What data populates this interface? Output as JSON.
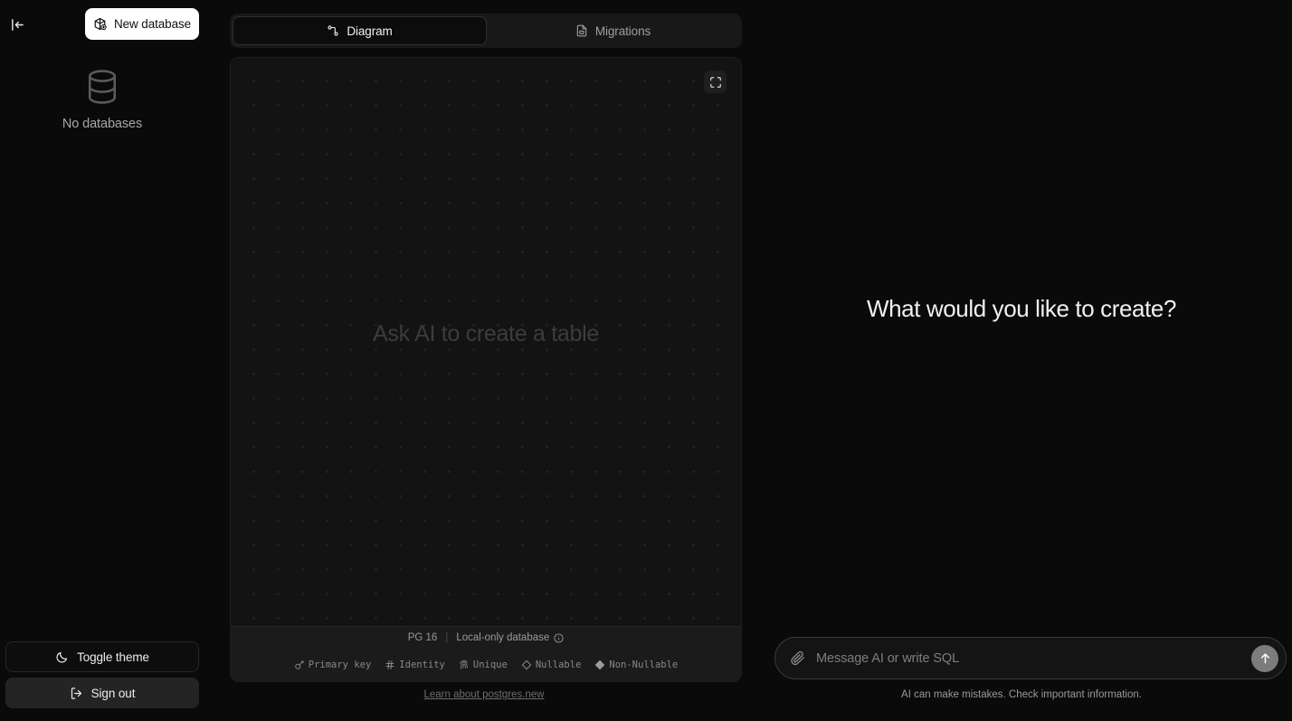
{
  "sidebar": {
    "collapse_icon": "panel-collapse-left-icon",
    "new_database": {
      "label": "New database",
      "icon": "database-plus-icon"
    },
    "empty_state": {
      "icon": "database-cylinder-icon",
      "label": "No databases"
    },
    "footer_buttons": [
      {
        "label": "Toggle theme",
        "icon": "moon-icon"
      },
      {
        "label": "Sign out",
        "icon": "sign-out-icon"
      }
    ]
  },
  "tabs": [
    {
      "label": "Diagram",
      "icon": "workflow-nodes-icon",
      "active": true
    },
    {
      "label": "Migrations",
      "icon": "file-document-icon",
      "active": false
    }
  ],
  "canvas": {
    "hint": "Ask AI to create a table",
    "fullscreen_icon": "fullscreen-expand-icon"
  },
  "status_bar": {
    "version": "PG 16",
    "separator": "|",
    "database_scope": "Local-only database",
    "info_icon": "info-circle-icon"
  },
  "legend": [
    {
      "label": "Primary key",
      "icon": "key-icon"
    },
    {
      "label": "Identity",
      "icon": "hash-icon"
    },
    {
      "label": "Unique",
      "icon": "fingerprint-icon"
    },
    {
      "label": "Nullable",
      "icon": "diamond-outline-icon"
    },
    {
      "label": "Non-Nullable",
      "icon": "diamond-filled-icon"
    }
  ],
  "learn_link": "Learn about postgres.new",
  "ai_panel": {
    "headline": "What would you like to create?",
    "composer": {
      "attach_icon": "paperclip-icon",
      "placeholder": "Message AI or write SQL",
      "value": "",
      "send_icon": "arrow-up-icon"
    },
    "disclaimer": "AI can make mistakes. Check important information."
  },
  "colors": {
    "background": "#0a0a0a",
    "panel": "#131313",
    "accent_button": "#ffffff",
    "send_button": "#7c7c7c"
  }
}
